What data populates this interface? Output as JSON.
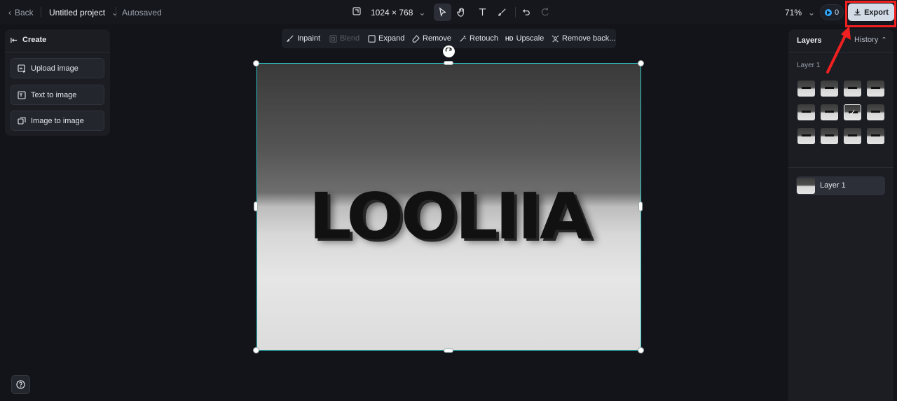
{
  "header": {
    "back_label": "Back",
    "project_name": "Untitled project",
    "save_status": "Autosaved",
    "canvas_size": "1024 × 768",
    "zoom": "71%",
    "credits": "0",
    "export_label": "Export"
  },
  "create_panel": {
    "title": "Create",
    "buttons": [
      "Upload image",
      "Text to image",
      "Image to image"
    ]
  },
  "edit_toolbar": {
    "inpaint": "Inpaint",
    "blend": "Blend",
    "expand": "Expand",
    "remove": "Remove",
    "retouch": "Retouch",
    "upscale_badge": "HD",
    "upscale": "Upscale",
    "remove_background": "Remove back..."
  },
  "canvas": {
    "image_text": "LOOLIIA"
  },
  "layers_panel": {
    "title": "Layers",
    "history_label": "History",
    "group_label": "Layer 1",
    "variation_count": 12,
    "selected_variation": 7,
    "layer_name": "Layer 1"
  },
  "colors": {
    "accent_selection": "#2bc5c5",
    "export_button": "#d2dbe6",
    "annotation_red": "#f02020"
  }
}
